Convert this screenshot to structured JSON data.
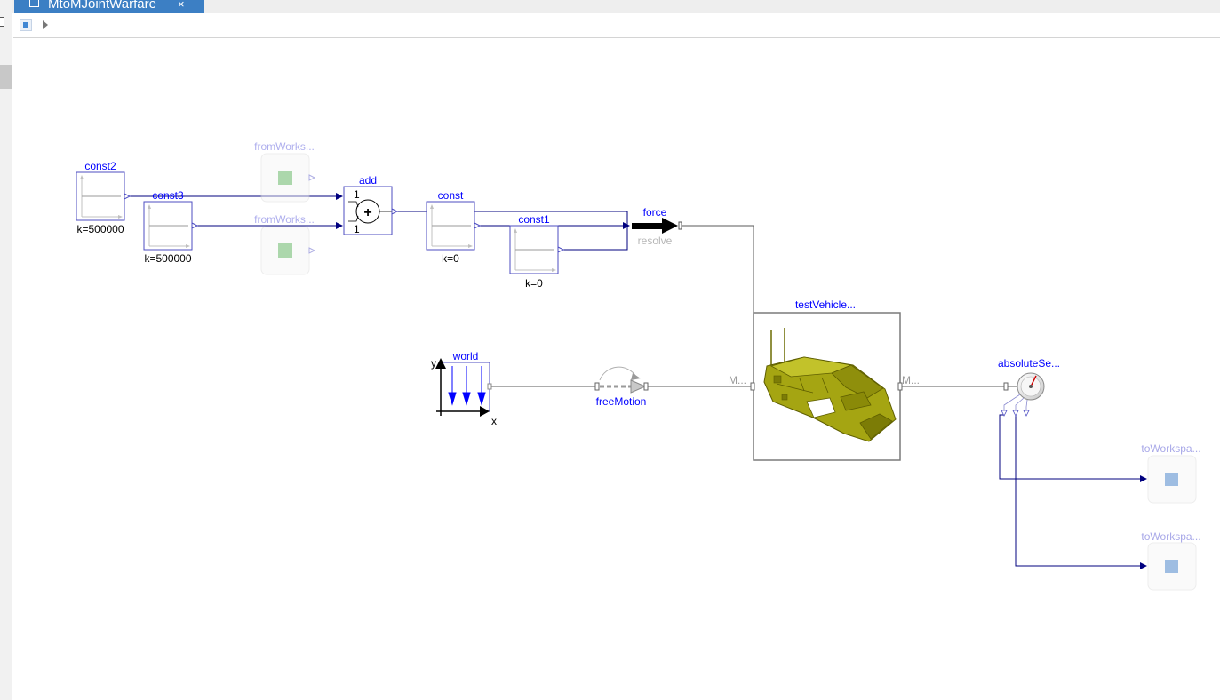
{
  "window": {
    "tab_title": "MtoMJointWarfare",
    "tab_close": "×"
  },
  "toolbar": {
    "items": [
      {
        "name": "model-icon"
      },
      {
        "name": "expand-arrow-icon"
      }
    ]
  },
  "diagram": {
    "blocks": {
      "const2": {
        "name": "const2",
        "param": "k=500000"
      },
      "const3": {
        "name": "const3",
        "param": "k=500000"
      },
      "fromWorkspace1": {
        "name": "fromWorks..."
      },
      "fromWorkspace2": {
        "name": "fromWorks..."
      },
      "add": {
        "name": "add",
        "gain1": "1",
        "gain2": "1",
        "symbol": "+"
      },
      "const": {
        "name": "const",
        "param": "k=0"
      },
      "const1": {
        "name": "const1",
        "param": "k=0"
      },
      "force": {
        "name": "force",
        "sublabel": "resolve"
      },
      "testVehicle": {
        "name": "testVehicle...",
        "port_left": "M...",
        "port_right": "M..."
      },
      "world": {
        "name": "world",
        "axis_y": "y",
        "axis_x": "x"
      },
      "freeMotion": {
        "name": "freeMotion"
      },
      "absoluteSensor": {
        "name": "absoluteSe..."
      },
      "toWorkspace1": {
        "name": "toWorkspa..."
      },
      "toWorkspace2": {
        "name": "toWorkspa..."
      }
    },
    "colors": {
      "block_label": "#0000ff",
      "block_border": "#4d4dc2",
      "signal_line": "#00007f",
      "mechanical_line": "#5a5a5a",
      "faded_label": "#a8a8e8",
      "vehicle_body": "#a5a512",
      "world_arrow": "#0000ff"
    }
  }
}
